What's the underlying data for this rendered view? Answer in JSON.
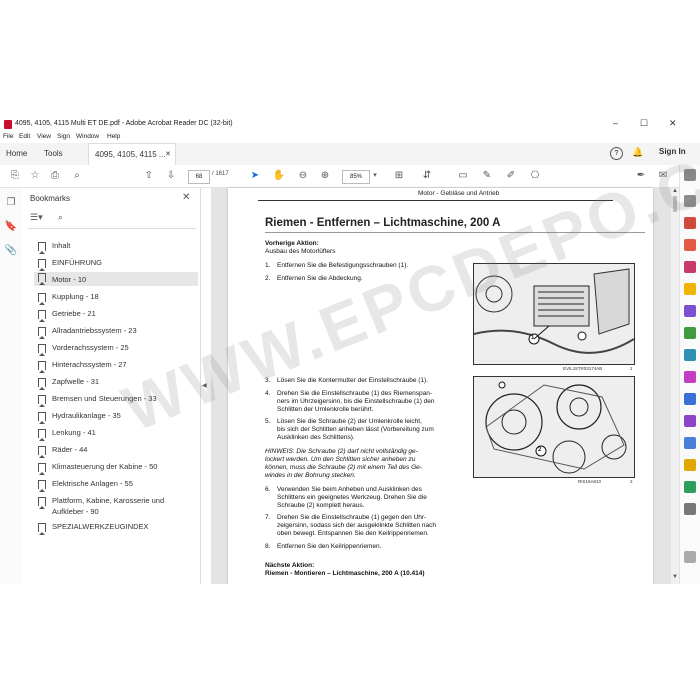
{
  "window": {
    "title": "4095, 4105, 4115 Multi ET DE.pdf - Adobe Acrobat Reader DC (32-bit)",
    "controls": [
      "–",
      "☐",
      "✕"
    ]
  },
  "menu": [
    "File",
    "Edit",
    "View",
    "Sign",
    "Window",
    "Help"
  ],
  "tabs": {
    "home": "Home",
    "tools": "Tools",
    "doc": "4095, 4105, 4115 ...",
    "doc_close": "✕",
    "signin": "Sign In"
  },
  "toolbar": {
    "page_current": "68",
    "page_sep": "/",
    "page_total": "1617",
    "zoom": "85%"
  },
  "bookmarks": {
    "header": "Bookmarks",
    "close": "✕",
    "items": [
      {
        "label": "Inhalt"
      },
      {
        "label": "EINFÜHRUNG"
      },
      {
        "label": "Motor - 10"
      },
      {
        "label": "Kupplung - 18"
      },
      {
        "label": "Getriebe - 21"
      },
      {
        "label": "Allradantriebssystem - 23"
      },
      {
        "label": "Vorderachssystem - 25"
      },
      {
        "label": "Hinterachssystem - 27"
      },
      {
        "label": "Zapfwelle - 31"
      },
      {
        "label": "Bremsen und Steuerungen - 33"
      },
      {
        "label": "Hydraulikanlage - 35"
      },
      {
        "label": "Lenkung - 41"
      },
      {
        "label": "Räder - 44"
      },
      {
        "label": "Klimasteuerung der Kabine - 50"
      },
      {
        "label": "Elektrische Anlagen - 55"
      },
      {
        "label": "Plattform, Kabine, Karosserie und"
      },
      {
        "label": "Aufkleber - 90"
      },
      {
        "label": "SPEZIALWERKZEUGINDEX"
      }
    ]
  },
  "document": {
    "section": "Motor - Gebläse und Antrieb",
    "title": "Riemen - Entfernen – Lichtmaschine, 200 A",
    "prev_action_label": "Vorherige Aktion:",
    "prev_action": "Ausbau des Motorlüfters",
    "steps": [
      {
        "n": "1.",
        "lines": [
          "Entfernen Sie die Befestigungsschrauben (1)."
        ]
      },
      {
        "n": "2.",
        "lines": [
          "Entfernen Sie die Abdeckung."
        ]
      },
      {
        "n": "3.",
        "lines": [
          "Lösen Sie die Kontermutter der Einstellschraube (1)."
        ]
      },
      {
        "n": "4.",
        "lines": [
          "Drehen Sie die Einstellschraube (1) des Riemenspan-",
          "ners im Uhrzeigersinn, bis die Einstellschraube (1) den",
          "Schlitten der Umlenkrolle berührt."
        ]
      },
      {
        "n": "5.",
        "lines": [
          "Lösen Sie die Schraube (2) der Umlenkrolle leicht,",
          "bis sich der Schlitten anheben lässt (Vorbereitung zum",
          "Ausklinken des Schlittens)."
        ]
      },
      {
        "n": "6.",
        "lines": [
          "Verwenden Sie beim Anheben und Ausklinken des",
          "Schlittens ein geeignetes Werkzeug. Drehen Sie die",
          "Schraube (2) komplett heraus."
        ]
      },
      {
        "n": "7.",
        "lines": [
          "Drehen Sie die Einstellschraube (1) gegen den Uhr-",
          "zeigersinn, sodass sich der ausgeklinkte Schlitten nach",
          "oben bewegt. Entspannen Sie den Keilrippenriemen."
        ]
      },
      {
        "n": "8.",
        "lines": [
          "Entfernen Sie den Keilrippenriemen."
        ]
      }
    ],
    "note_lines": [
      "HINWEIS: Die Schraube (2) darf nicht vollständig ge-",
      "lockert werden. Um den Schlitten sicher anheben zu",
      "können, muss die Schraube (2) mit einem Teil des Ge-",
      "windes in der Bohrung stecken."
    ],
    "next_action_label": "Nächste Aktion:",
    "next_action": "Riemen - Montieren – Lichtmaschine, 200 A (10.414)",
    "fig1_caption": "EVIL15TR03174AB",
    "fig1_num": "1",
    "fig2_caption": "RIS15A810",
    "fig2_num": "2",
    "callout_1": "1",
    "callout_2": "2"
  },
  "watermark": "WWW.EPCDEPO.COM"
}
